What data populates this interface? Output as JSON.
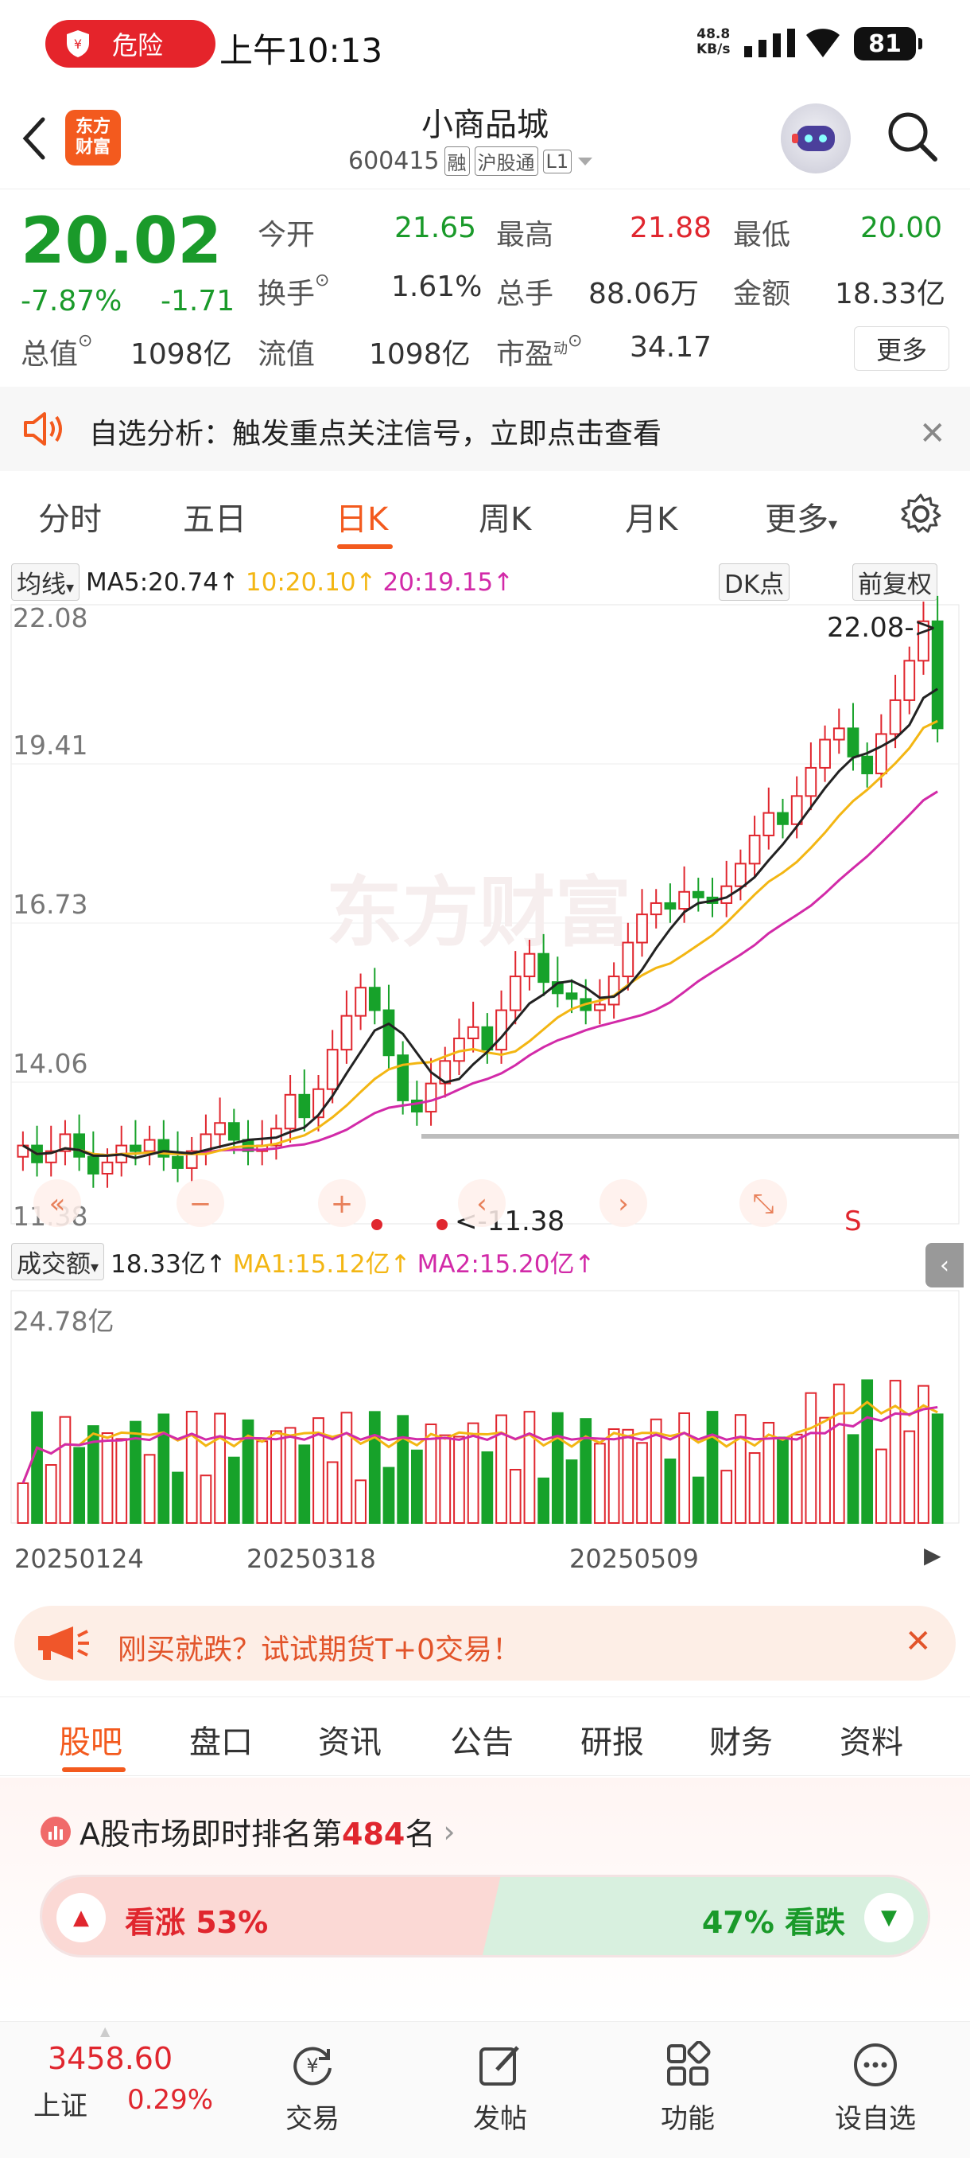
{
  "status_bar": {
    "danger_label": "危险",
    "time": "上午10:13",
    "net_speed_value": "48.8",
    "net_speed_unit": "KB/s",
    "battery": "81"
  },
  "header": {
    "logo_line1": "东方",
    "logo_line2": "财富",
    "name": "小商品城",
    "code": "600415",
    "tag1": "融",
    "tag2": "沪股通",
    "tag3": "L1"
  },
  "quote": {
    "price": "20.02",
    "change_pct": "-7.87%",
    "change_abs": "-1.71",
    "open_label": "今开",
    "open": "21.65",
    "high_label": "最高",
    "high": "21.88",
    "low_label": "最低",
    "low": "20.00",
    "turnover_label": "换手",
    "turnover": "1.61%",
    "volume_label": "总手",
    "volume": "88.06万",
    "amount_label": "金额",
    "amount": "18.33亿",
    "mktcap_label": "总值",
    "mktcap": "1098亿",
    "float_label": "流值",
    "float_cap": "1098亿",
    "pe_label": "市盈",
    "pe_sup": "动",
    "pe": "34.17",
    "more": "更多"
  },
  "alert": {
    "text": "自选分析：触发重点关注信号，立即点击查看"
  },
  "chart_tabs": [
    "分时",
    "五日",
    "日K",
    "周K",
    "月K",
    "更多"
  ],
  "kline": {
    "ma_selector": "均线",
    "ma5": "MA5:20.74",
    "ma10": "10:20.10",
    "ma20": "20:19.15",
    "dk": "DK点",
    "restore": "前复权",
    "y_ticks": [
      "22.08",
      "19.41",
      "16.73",
      "14.06",
      "11.38"
    ],
    "high_marker": "22.08->",
    "low_marker": "<-11.38",
    "s_marker": "S",
    "vol_selector": "成交额",
    "vol_value": "18.33亿",
    "vol_ma1": "MA1:15.12亿",
    "vol_ma2": "MA2:15.20亿",
    "vol_max": "24.78亿",
    "x_ticks": [
      "20250124",
      "20250318",
      "20250509"
    ]
  },
  "chart_data": {
    "type": "candlestick",
    "y_range": [
      11.38,
      22.08
    ],
    "close_trend": [
      12.6,
      12.3,
      12.5,
      12.8,
      12.4,
      12.1,
      12.3,
      12.6,
      12.5,
      12.7,
      12.4,
      12.2,
      12.5,
      12.8,
      13.0,
      12.7,
      12.5,
      12.6,
      12.9,
      13.5,
      13.1,
      13.6,
      14.3,
      14.9,
      15.4,
      15.0,
      14.2,
      13.4,
      13.2,
      13.7,
      14.1,
      14.5,
      14.7,
      14.3,
      15.0,
      15.6,
      16.0,
      15.5,
      15.3,
      15.2,
      15.0,
      15.1,
      15.6,
      16.2,
      16.7,
      16.9,
      16.8,
      17.1,
      17.0,
      16.9,
      17.2,
      17.6,
      18.1,
      18.5,
      18.3,
      18.8,
      19.3,
      19.8,
      20.0,
      19.5,
      19.2,
      19.9,
      20.5,
      21.2,
      21.9,
      20.0
    ],
    "ma5": "20.74",
    "ma10": "20.10",
    "ma20": "19.15",
    "volume_max_label": "24.78亿"
  },
  "promo": {
    "text": "刚买就跌？试试期货T+0交易！"
  },
  "bottom_tabs": [
    "股吧",
    "盘口",
    "资讯",
    "公告",
    "研报",
    "财务",
    "资料"
  ],
  "ranking": {
    "prefix": "A股市场即时排名第",
    "rank": "484",
    "suffix": "名"
  },
  "vote": {
    "up": "看涨 53%",
    "down": "47% 看跌"
  },
  "nav": {
    "index_value": "3458.60",
    "index_name": "上证",
    "index_pct": "0.29%",
    "trade": "交易",
    "post": "发帖",
    "func": "功能",
    "watch": "设自选"
  }
}
